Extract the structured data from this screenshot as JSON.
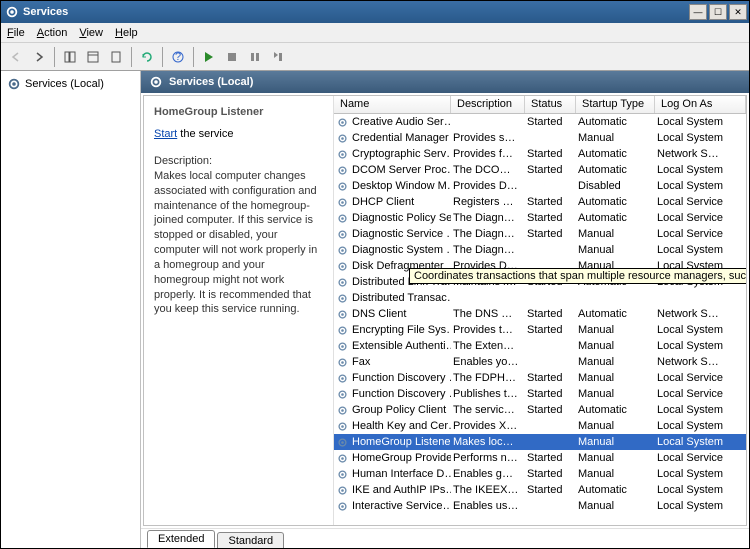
{
  "window": {
    "title": "Services"
  },
  "menus": [
    "File",
    "Action",
    "View",
    "Help"
  ],
  "tree": {
    "root": "Services (Local)"
  },
  "header": {
    "title": "Services (Local)"
  },
  "detail": {
    "name": "HomeGroup Listener",
    "actionLink": "Start",
    "actionSuffix": " the service",
    "descLabel": "Description:",
    "descText": "Makes local computer changes associated with configuration and maintenance of the homegroup-joined computer. If this service is stopped or disabled, your computer will not work properly in a homegroup and your homegroup might not work properly. It is recommended that you keep this service running."
  },
  "columns": [
    "Name",
    "Description",
    "Status",
    "Startup Type",
    "Log On As"
  ],
  "tooltip": "Coordinates transactions that span multiple resource managers, such a",
  "tooltipTop": 172,
  "services": [
    {
      "name": "Creative Audio Ser…",
      "desc": "",
      "status": "Started",
      "startup": "Automatic",
      "logon": "Local System"
    },
    {
      "name": "Credential Manager",
      "desc": "Provides s…",
      "status": "",
      "startup": "Manual",
      "logon": "Local System"
    },
    {
      "name": "Cryptographic Serv…",
      "desc": "Provides fo…",
      "status": "Started",
      "startup": "Automatic",
      "logon": "Network S…"
    },
    {
      "name": "DCOM Server Proc…",
      "desc": "The DCOM…",
      "status": "Started",
      "startup": "Automatic",
      "logon": "Local System"
    },
    {
      "name": "Desktop Window M…",
      "desc": "Provides D…",
      "status": "",
      "startup": "Disabled",
      "logon": "Local System"
    },
    {
      "name": "DHCP Client",
      "desc": "Registers a…",
      "status": "Started",
      "startup": "Automatic",
      "logon": "Local Service"
    },
    {
      "name": "Diagnostic Policy Se…",
      "desc": "The Diagno…",
      "status": "Started",
      "startup": "Automatic",
      "logon": "Local Service"
    },
    {
      "name": "Diagnostic Service …",
      "desc": "The Diagno…",
      "status": "Started",
      "startup": "Manual",
      "logon": "Local Service"
    },
    {
      "name": "Diagnostic System …",
      "desc": "The Diagno…",
      "status": "",
      "startup": "Manual",
      "logon": "Local System"
    },
    {
      "name": "Disk Defragmenter",
      "desc": "Provides Di…",
      "status": "",
      "startup": "Manual",
      "logon": "Local System"
    },
    {
      "name": "Distributed Link Tra…",
      "desc": "Maintains li…",
      "status": "Started",
      "startup": "Automatic",
      "logon": "Local System"
    },
    {
      "name": "Distributed Transac…",
      "desc": "",
      "status": "",
      "startup": "",
      "logon": ""
    },
    {
      "name": "DNS Client",
      "desc": "The DNS Cl…",
      "status": "Started",
      "startup": "Automatic",
      "logon": "Network S…"
    },
    {
      "name": "Encrypting File Sys…",
      "desc": "Provides th…",
      "status": "Started",
      "startup": "Manual",
      "logon": "Local System"
    },
    {
      "name": "Extensible Authenti…",
      "desc": "The Extens…",
      "status": "",
      "startup": "Manual",
      "logon": "Local System"
    },
    {
      "name": "Fax",
      "desc": "Enables yo…",
      "status": "",
      "startup": "Manual",
      "logon": "Network S…"
    },
    {
      "name": "Function Discovery …",
      "desc": "The FDPH…",
      "status": "Started",
      "startup": "Manual",
      "logon": "Local Service"
    },
    {
      "name": "Function Discovery …",
      "desc": "Publishes t…",
      "status": "Started",
      "startup": "Manual",
      "logon": "Local Service"
    },
    {
      "name": "Group Policy Client",
      "desc": "The servic…",
      "status": "Started",
      "startup": "Automatic",
      "logon": "Local System"
    },
    {
      "name": "Health Key and Cer…",
      "desc": "Provides X…",
      "status": "",
      "startup": "Manual",
      "logon": "Local System"
    },
    {
      "name": "HomeGroup Listener",
      "desc": "Makes local…",
      "status": "",
      "startup": "Manual",
      "logon": "Local System",
      "selected": true
    },
    {
      "name": "HomeGroup Provider",
      "desc": "Performs n…",
      "status": "Started",
      "startup": "Manual",
      "logon": "Local Service"
    },
    {
      "name": "Human Interface D…",
      "desc": "Enables ge…",
      "status": "Started",
      "startup": "Manual",
      "logon": "Local System"
    },
    {
      "name": "IKE and AuthIP IPs…",
      "desc": "The IKEEX…",
      "status": "Started",
      "startup": "Automatic",
      "logon": "Local System"
    },
    {
      "name": "Interactive Service…",
      "desc": "Enables us…",
      "status": "",
      "startup": "Manual",
      "logon": "Local System"
    }
  ],
  "tabs": {
    "extended": "Extended",
    "standard": "Standard"
  }
}
